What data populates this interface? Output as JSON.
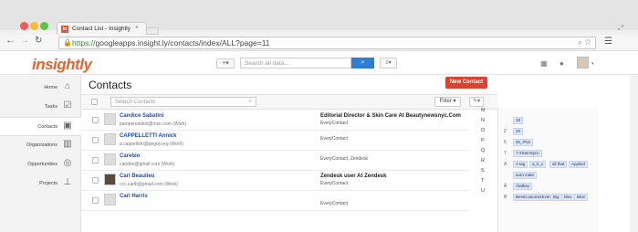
{
  "browser": {
    "tab_title": "Contact List - Insightly",
    "tab_favicon": "in",
    "tab_close": "×",
    "url_scheme": "https://",
    "url_rest": "googleapps.insight.ly/contacts/index/ALL?page=11",
    "traffic_lights": [
      "#ee5c54",
      "#f6bd3a",
      "#5fc343"
    ]
  },
  "app": {
    "logo": "insightly",
    "brand_color": "#e8642c",
    "search_placeholder": "Search all data...",
    "plus_label": "+▾"
  },
  "sidebar": {
    "items": [
      {
        "label": "Home",
        "icon": "house-icon"
      },
      {
        "label": "Tasks",
        "icon": "checkbox-icon"
      },
      {
        "label": "Contacts",
        "icon": "contact-card-icon"
      },
      {
        "label": "Organizations",
        "icon": "building-icon"
      },
      {
        "label": "Opportunities",
        "icon": "target-icon"
      },
      {
        "label": "Projects",
        "icon": "pin-icon"
      }
    ]
  },
  "main": {
    "title": "Contacts",
    "new_contact_label": "New Contact",
    "search_placeholder": "Search Contacts",
    "filter_label": "Filter ▾",
    "wrench_label": "✎▾"
  },
  "contacts": [
    {
      "name": "Candice Sabatini",
      "email": "pamperedskin@msn.com (Work)",
      "title": "Editorial Director & Skin Care At Beautynewsnyc.Com",
      "org": "EveryContact",
      "avatar_color": "#e8d5c4"
    },
    {
      "name": "CAPPELLETTI Annick",
      "email": "a.cappelletti@pegoy.org (Work)",
      "title": "",
      "org": "EveryContact",
      "avatar_color": "#e8d5c4"
    },
    {
      "name": "Carebio",
      "email": "carebio@gmail.com (Work)",
      "title": "",
      "org": "EveryContact, Zendesk",
      "avatar_color": "#e8d5c4"
    },
    {
      "name": "Carl Beaulieu",
      "email": "ccc.carlb@gmail.com (Work)",
      "title": "Zendesk user At Zendesk",
      "org": "EveryContact",
      "avatar_color": "#5a4a3a"
    },
    {
      "name": "Carl Harris",
      "email": "",
      "title": "",
      "org": "EveryContact",
      "avatar_color": "#e8d5c4"
    }
  ],
  "letters": [
    "M",
    "N",
    "O",
    "P",
    "Q",
    "R",
    "S",
    "T",
    "U"
  ],
  "tag_rows": [
    {
      "letter": "",
      "tags": [
        "19"
      ]
    },
    {
      "letter": "2",
      "tags": [
        "20"
      ]
    },
    {
      "letter": "5",
      "tags": [
        "50_Plus"
      ]
    },
    {
      "letter": "7",
      "tags": [
        "7-3SamSync"
      ]
    },
    {
      "letter": "A",
      "tags": [
        "A tag",
        "a_b_c",
        "all that",
        "Applied"
      ]
    },
    {
      "letter": "",
      "tags": [
        "auto mate"
      ]
    },
    {
      "letter": "Â",
      "tags": [
        "Âtatkey"
      ]
    },
    {
      "letter": "B",
      "tags": [
        "BestCustomerEver",
        "Big",
        "bleu",
        "Blue"
      ]
    }
  ]
}
